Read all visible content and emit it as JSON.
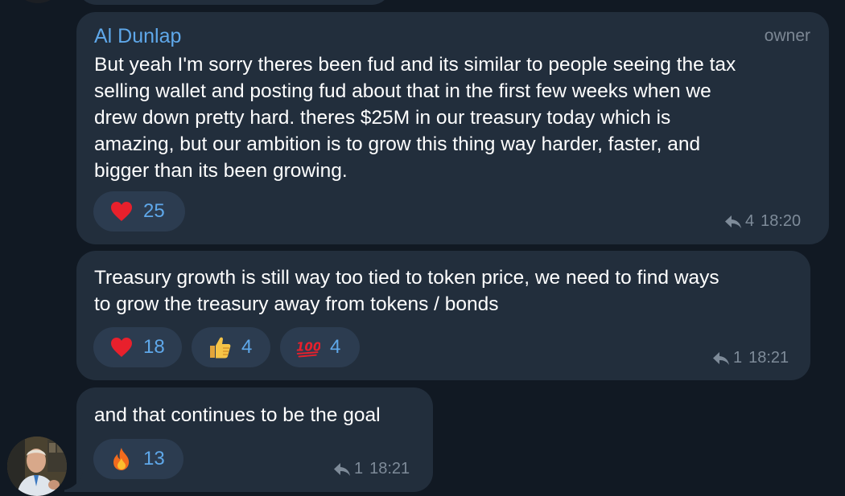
{
  "colors": {
    "background": "#111923",
    "bubble": "#222e3c",
    "reaction_bg": "#2c3c50",
    "accent": "#5fa8ea",
    "meta": "#7e8b99"
  },
  "messages": [
    {
      "sender": "Al Dunlap",
      "role": "owner",
      "text": "But yeah I'm sorry theres been fud and its similar to people seeing the tax\nselling wallet and posting fud about that in the first few weeks when we\ndrew down pretty hard. theres $25M in our treasury today which is\namazing, but our ambition is to grow this thing way harder, faster, and\nbigger than its been growing.",
      "reactions": [
        {
          "icon": "heart-icon",
          "count": "25"
        }
      ],
      "reply_count": "4",
      "time": "18:20"
    },
    {
      "text": "Treasury growth is still way too tied to token price, we need to find ways\nto grow the treasury away from tokens / bonds",
      "reactions": [
        {
          "icon": "heart-icon",
          "count": "18"
        },
        {
          "icon": "thumbs-up-icon",
          "count": "4"
        },
        {
          "icon": "hundred-points-icon",
          "count": "4"
        }
      ],
      "reply_count": "1",
      "time": "18:21"
    },
    {
      "text": "and that continues to be the goal",
      "reactions": [
        {
          "icon": "fire-icon",
          "count": "13"
        }
      ],
      "reply_count": "1",
      "time": "18:21"
    }
  ]
}
